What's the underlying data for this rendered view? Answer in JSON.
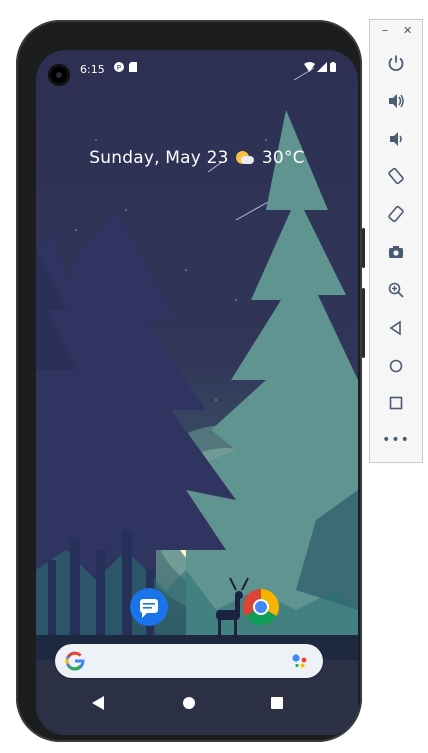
{
  "status_bar": {
    "time": "6:15"
  },
  "date_weather": {
    "date": "Sunday, May 23",
    "temperature": "30°C"
  },
  "apps": [
    {
      "name": "Messages"
    },
    {
      "name": "Chrome"
    }
  ],
  "search_bar": {
    "logo": "G"
  },
  "navigation": {
    "back": "back",
    "home": "home",
    "recents": "recents"
  },
  "toolbar": {
    "icons": [
      "power-icon",
      "volume-up-icon",
      "volume-down-icon",
      "rotate-left-icon",
      "rotate-right-icon",
      "camera-icon",
      "zoom-icon",
      "back-icon",
      "home-icon",
      "overview-icon",
      "more-icon"
    ],
    "more_label": "•••"
  },
  "colors": {
    "sky": "#2d3052",
    "trees": "#323862",
    "teal": "#5a8a8c",
    "moon": "#fbf2d7",
    "toolbar_icon": "#4a5b73"
  }
}
